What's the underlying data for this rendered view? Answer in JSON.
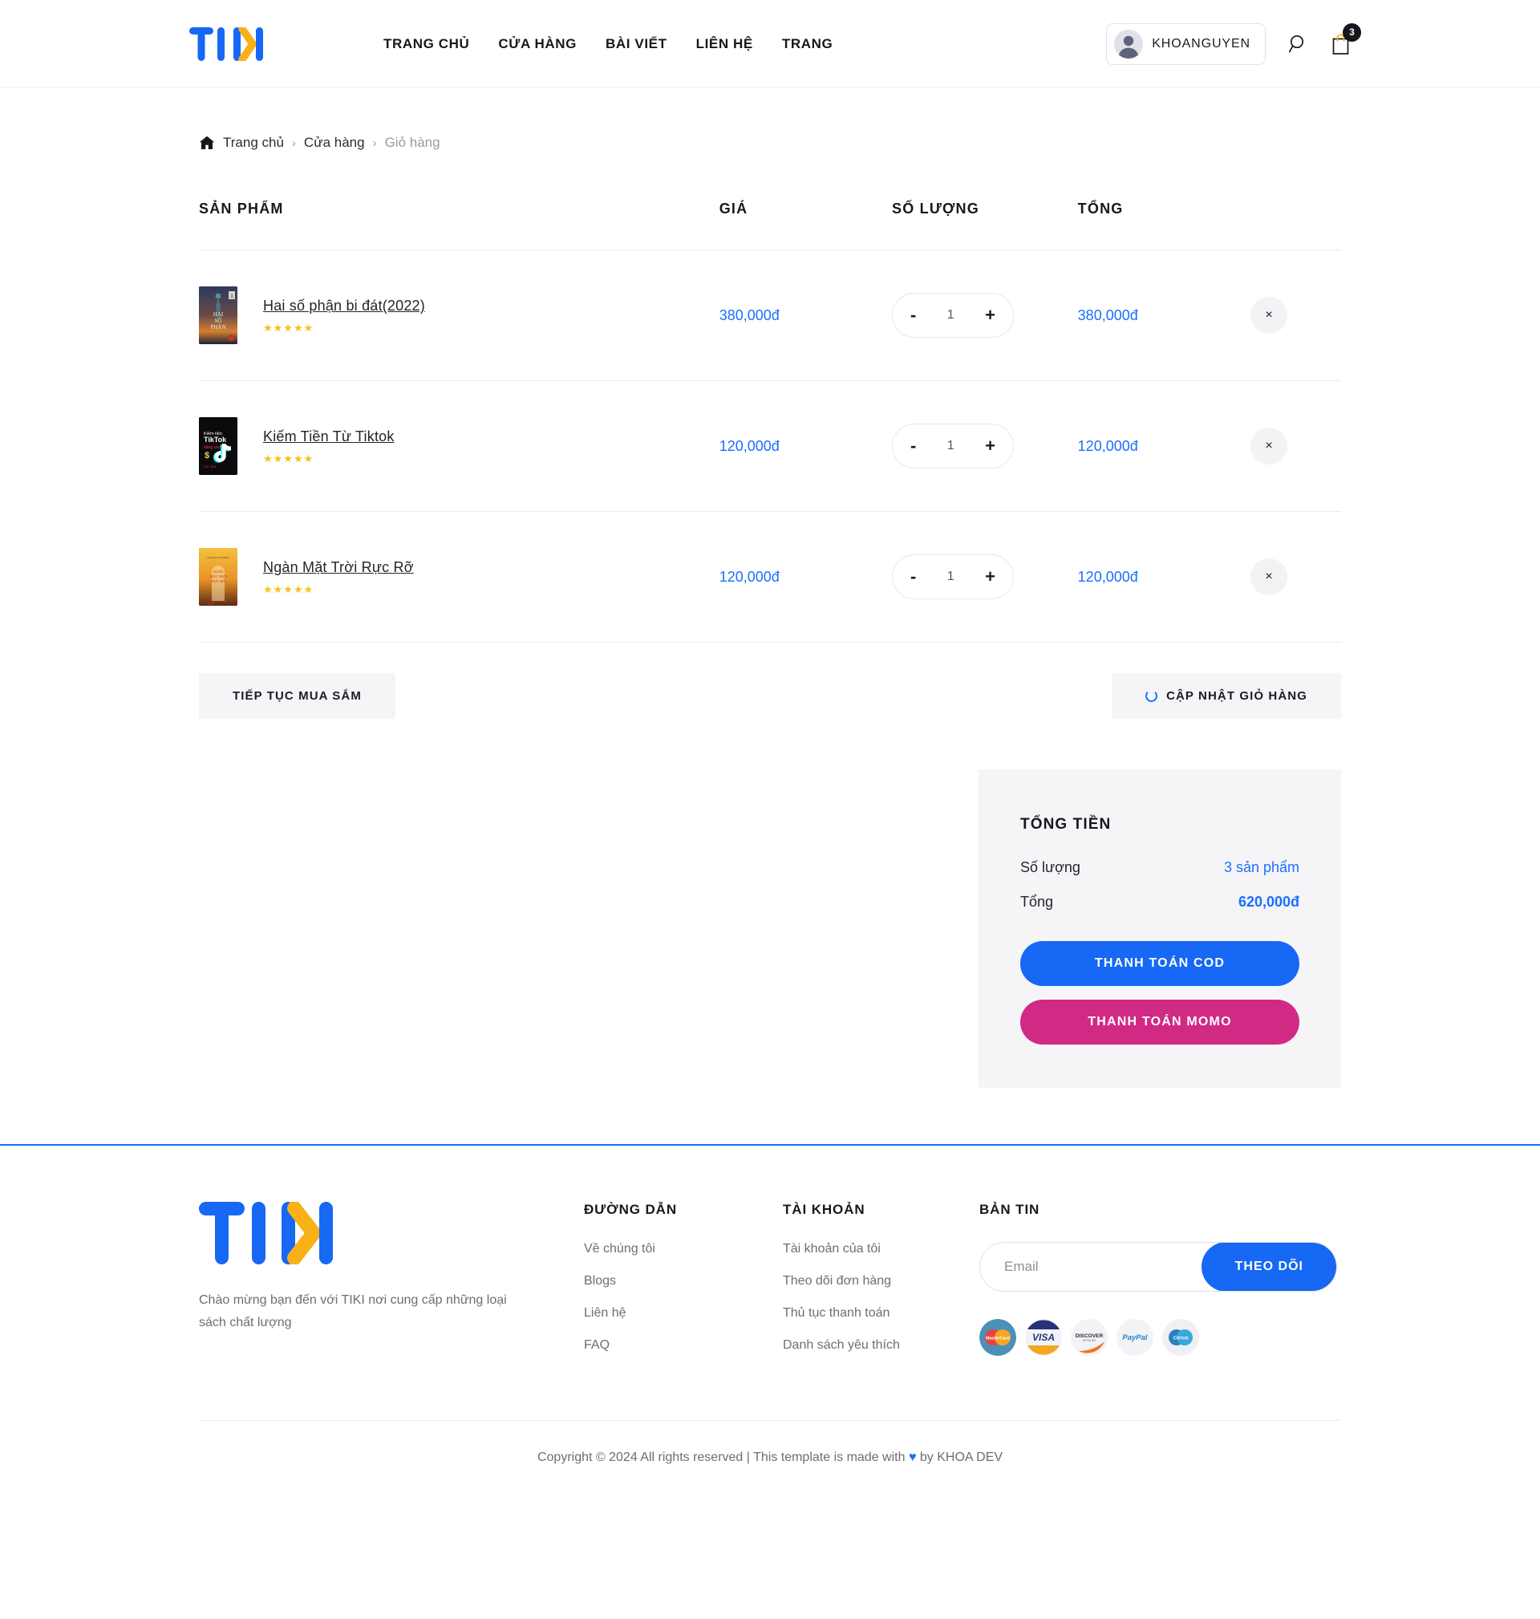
{
  "brand": {
    "name": "TIKI",
    "logo_colors": {
      "blue": "#1668f5",
      "yellow": "#f9b117"
    }
  },
  "header": {
    "nav": [
      {
        "label": "TRANG CHỦ"
      },
      {
        "label": "CỬA HÀNG"
      },
      {
        "label": "BÀI VIẾT"
      },
      {
        "label": "LIÊN HỆ"
      },
      {
        "label": "TRANG"
      }
    ],
    "user": {
      "name": "KHOANGUYEN",
      "avatar_icon": "user-avatar-icon"
    },
    "search_icon": "search-icon",
    "cart_icon": "shopping-bag-icon",
    "cart_count": "3"
  },
  "breadcrumb": {
    "home_icon": "home-icon",
    "items": [
      {
        "label": "Trang chủ",
        "current": false
      },
      {
        "label": "Cửa hàng",
        "current": false
      },
      {
        "label": "Giỏ hàng",
        "current": true
      }
    ],
    "separator": "›"
  },
  "cart": {
    "headers": {
      "product": "SẢN PHẨM",
      "price": "GIÁ",
      "quantity": "SỐ LƯỢNG",
      "total": "TỔNG"
    },
    "items": [
      {
        "title": "Hai số phận bi đát(2022)",
        "rating": "★★★★★",
        "price": "380,000đ",
        "qty": "1",
        "line_total": "380,000đ",
        "cover": "statue-of-liberty-book-cover",
        "remove_label": "×"
      },
      {
        "title": "Kiếm Tiền Từ Tiktok",
        "rating": "★★★★★",
        "price": "120,000đ",
        "qty": "1",
        "line_total": "120,000đ",
        "cover": "tiktok-book-cover",
        "remove_label": "×"
      },
      {
        "title": "Ngàn Mặt Trời Rực Rỡ",
        "rating": "★★★★★",
        "price": "120,000đ",
        "qty": "1",
        "line_total": "120,000đ",
        "cover": "golden-sun-book-cover",
        "remove_label": "×"
      }
    ],
    "decrement_label": "-",
    "increment_label": "+",
    "continue_shopping": "TIẾP TỤC MUA SẮM",
    "update_cart": "CẬP NHẬT GIỎ HÀNG"
  },
  "totals": {
    "title": "TỔNG TIỀN",
    "quantity_label": "Số lượng",
    "quantity_value": "3 sản phẩm",
    "total_label": "Tổng",
    "total_value": "620,000đ",
    "cod_button": "THANH TOÁN COD",
    "momo_button": "THANH TOÁN MOMO",
    "cod_color": "#1668f5",
    "momo_color": "#d02a85"
  },
  "footer": {
    "tagline": "Chào mừng bạn đến với TIKI nơi cung cấp những loại sách chất lượng",
    "links_title": "ĐƯỜNG DẪN",
    "links": [
      {
        "label": "Về chúng tôi"
      },
      {
        "label": "Blogs"
      },
      {
        "label": "Liên hệ"
      },
      {
        "label": "FAQ"
      }
    ],
    "account_title": "TÀI KHOẢN",
    "account_links": [
      {
        "label": "Tài khoản của tôi"
      },
      {
        "label": "Theo dõi đơn hàng"
      },
      {
        "label": "Thủ tục thanh toán"
      },
      {
        "label": "Danh sách yêu thích"
      }
    ],
    "newsletter_title": "BẢN TIN",
    "newsletter_placeholder": "Email",
    "newsletter_value": "",
    "newsletter_button": "THEO DÕI",
    "payment_icons": [
      {
        "name": "mastercard-icon",
        "label": "MasterCard"
      },
      {
        "name": "visa-icon",
        "label": "VISA"
      },
      {
        "name": "discover-icon",
        "label": "DISCOVER"
      },
      {
        "name": "paypal-icon",
        "label": "PayPal"
      },
      {
        "name": "cirrus-icon",
        "label": "Cirrus"
      }
    ],
    "copyright_pre": "Copyright © 2024 All rights reserved | This template is made with ",
    "copyright_heart": "♥",
    "copyright_post": " by KHOA DEV"
  }
}
